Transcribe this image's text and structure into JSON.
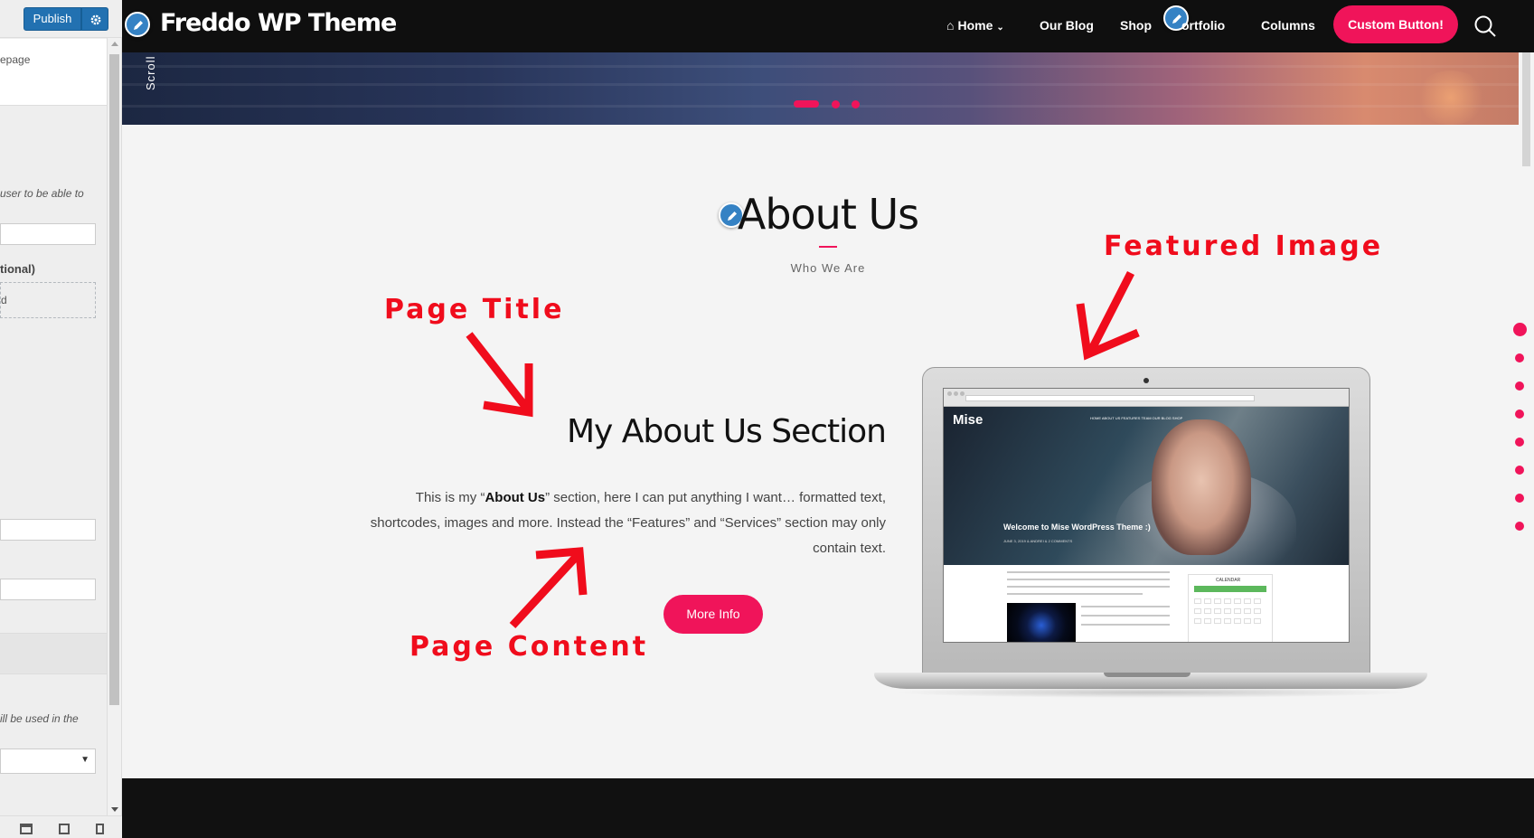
{
  "customizer": {
    "publish_label": "Publish",
    "settings_icon": "gear-icon",
    "text_homepage": "epage",
    "text_able_to": "user to be able to",
    "text_optional": "tional)",
    "text_dashed": "d",
    "text_used_in": "ill be used in the",
    "device_icons": [
      "desktop-icon",
      "tablet-icon",
      "mobile-icon"
    ]
  },
  "site": {
    "logo": "Freddo WP Theme",
    "nav": [
      {
        "label": "Home",
        "icon": "home-icon",
        "has_dropdown": true
      },
      {
        "label": "Our Blog"
      },
      {
        "label": "Shop"
      },
      {
        "label": "ortfolio"
      },
      {
        "label": "Columns"
      }
    ],
    "custom_button": "Custom Button!",
    "search_icon": "search-icon",
    "hero_scroll_label": "Scroll",
    "about": {
      "title": "About Us",
      "subtitle": "Who We Are",
      "section_title": "My About Us Section",
      "body_before": "This is my “",
      "body_bold": "About Us",
      "body_after": "” section, here I can put anything I want… formatted text, shortcodes, images and more. Instead the “Features” and “Services” section may only contain text.",
      "button": "More Info"
    },
    "laptop_screen": {
      "logo": "Mise",
      "menu": "HOME  ABOUT US  FEATURES  TEAM  OUR BLOG  SHOP",
      "post_title": "Welcome to Mise WordPress Theme :)",
      "meta": "JUNE 3, 2019  &  ANDREI  &  2 COMMENTS",
      "calendar_label": "CALENDAR"
    }
  },
  "annotations": {
    "page_title": "Page Title",
    "page_content": "Page Content",
    "featured_image": "Featured Image"
  },
  "colors": {
    "accent": "#f0145a",
    "annotation": "#f00c1c",
    "wp_blue": "#2271b1",
    "nav_bg": "#0f0f0f"
  }
}
